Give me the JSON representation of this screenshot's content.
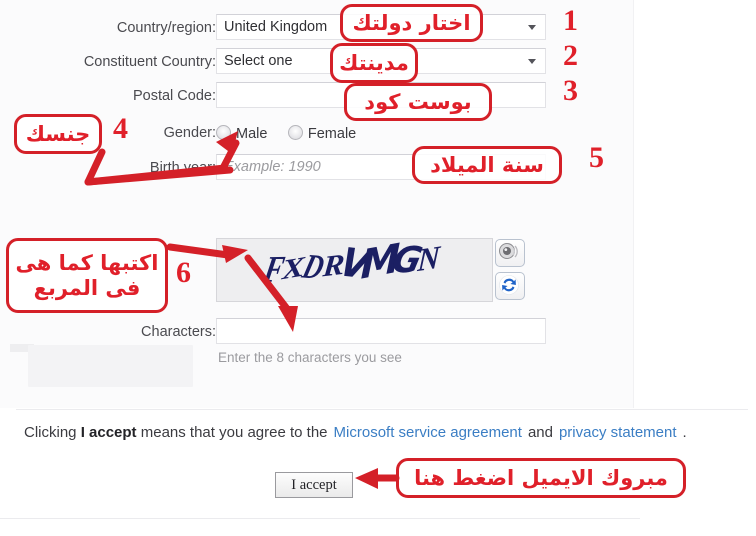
{
  "form": {
    "fields": [
      {
        "label": "Country/region:",
        "type": "select",
        "value": "United Kingdom"
      },
      {
        "label": "Constituent Country:",
        "type": "select",
        "value": "Select one"
      },
      {
        "label": "Postal Code:",
        "type": "text",
        "value": "",
        "placeholder": ""
      },
      {
        "label": "Gender:",
        "type": "radio"
      },
      {
        "label": "Birth year:",
        "type": "text",
        "value": "",
        "placeholder": "Example: 1990"
      },
      {
        "label": "Characters:",
        "type": "text",
        "value": "",
        "placeholder": ""
      }
    ],
    "gender_options": [
      "Male",
      "Female"
    ],
    "captcha_text": "FXDRVMGN",
    "captcha_hint": "Enter the 8 characters you see",
    "audio_icon": "speaker-icon",
    "refresh_icon": "refresh-icon"
  },
  "agreement": {
    "prefix": "Clicking ",
    "bold": "I accept",
    "middle": " means that you agree to the",
    "link1": "Microsoft service agreement",
    "conjunction": "and",
    "link2": "privacy statement",
    "suffix": ".",
    "button_label": "I accept"
  },
  "annotations": {
    "numbers": [
      "1",
      "2",
      "3",
      "4",
      "5",
      "6"
    ],
    "notes": [
      {
        "id": "country",
        "text": "اختار دولتك"
      },
      {
        "id": "city",
        "text": "مدينتك"
      },
      {
        "id": "postcode",
        "text": "بوست كود"
      },
      {
        "id": "gender",
        "text": "جنسك"
      },
      {
        "id": "birthyear",
        "text": "سنة الميلاد"
      },
      {
        "id": "captcha",
        "text": "اكتبها كما هى\nفى المربع"
      },
      {
        "id": "accept",
        "text": "مبروك الايميل اضغط هنا"
      }
    ],
    "accent_color": "#d42028",
    "number_color": "#e0202a"
  }
}
